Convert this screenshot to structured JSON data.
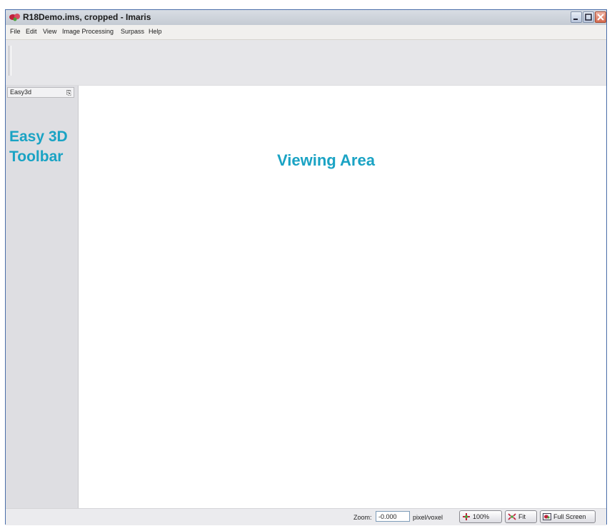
{
  "window": {
    "title": "R18Demo.ims, cropped  - Imaris",
    "app_icon": "imaris-logo-icon"
  },
  "menu": {
    "items": [
      "File",
      "Edit",
      "View",
      "Image Processing",
      "Surpass",
      "Help"
    ]
  },
  "side_panel": {
    "header": "Easy3d",
    "pin_icon": "pin-icon",
    "label": "Easy 3D\nToolbar"
  },
  "view_area": {
    "label": "Viewing Area"
  },
  "statusbar": {
    "zoom_label": "Zoom:",
    "zoom_value": "-0.000",
    "unit_label": "pixel/voxel",
    "btn_100": "100%",
    "btn_fit": "Fit",
    "btn_fullscreen": "Full Screen"
  },
  "colors": {
    "annotation": "#1aa3c4"
  }
}
